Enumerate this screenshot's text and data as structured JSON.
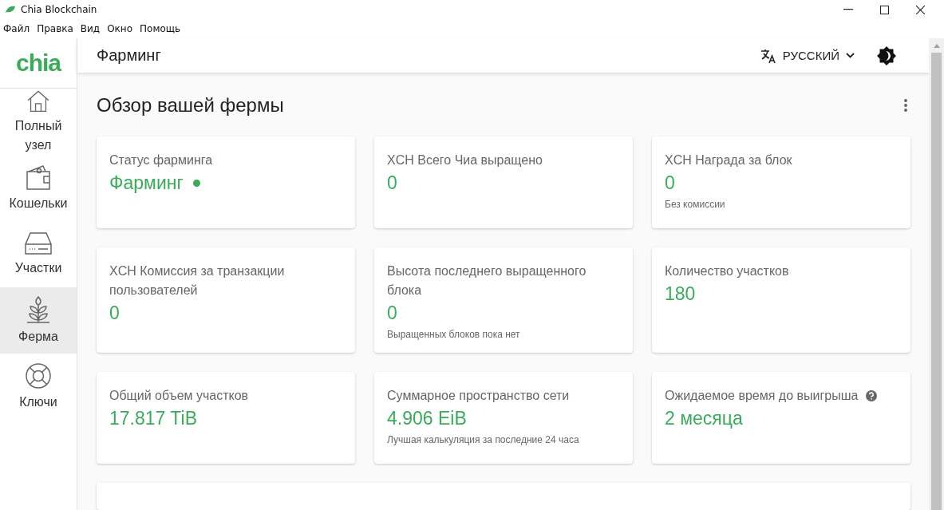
{
  "window": {
    "title": "Chia Blockchain"
  },
  "menu": [
    "Файл",
    "Правка",
    "Вид",
    "Окно",
    "Помощь"
  ],
  "logo": "chia",
  "header": {
    "title": "Фарминг",
    "language": "РУССКИЙ"
  },
  "sidebar": {
    "items": [
      {
        "label": "Полный узел",
        "kind": "home",
        "selected": false
      },
      {
        "label": "Кошельки",
        "kind": "wallet",
        "selected": false
      },
      {
        "label": "Участки",
        "kind": "drive",
        "selected": false
      },
      {
        "label": "Ферма",
        "kind": "plant",
        "selected": true
      },
      {
        "label": "Ключи",
        "kind": "lifebuoy",
        "selected": false
      }
    ]
  },
  "overview": {
    "title": "Обзор вашей фермы",
    "cards": [
      {
        "title": "Статус фарминга",
        "value": "Фарминг",
        "status_dot": true,
        "help": false
      },
      {
        "title": "XCH Всего Чиа выращено",
        "value": "0",
        "status_dot": false,
        "help": false
      },
      {
        "title": "XCH Награда за блок",
        "value": "0",
        "subtitle": "Без комиссии",
        "status_dot": false,
        "help": false
      },
      {
        "title": "XCH Комиссия за транзакции пользователей",
        "value": "0",
        "status_dot": false,
        "help": false
      },
      {
        "title": "Высота последнего выращенного блока",
        "value": "0",
        "subtitle": "Выращенных блоков пока нет",
        "status_dot": false,
        "help": false
      },
      {
        "title": "Количество участков",
        "value": "180",
        "status_dot": false,
        "help": false
      },
      {
        "title": "Общий объем участков",
        "value": "17.817 TiB",
        "status_dot": false,
        "help": false
      },
      {
        "title": "Суммарное пространство сети",
        "value": "4.906 EiB",
        "subtitle": "Лучшая калькуляция за последние 24 часа",
        "status_dot": false,
        "help": false
      },
      {
        "title": "Ожидаемое время до выигрыша",
        "value": "2 месяца",
        "status_dot": false,
        "help": true
      }
    ]
  }
}
